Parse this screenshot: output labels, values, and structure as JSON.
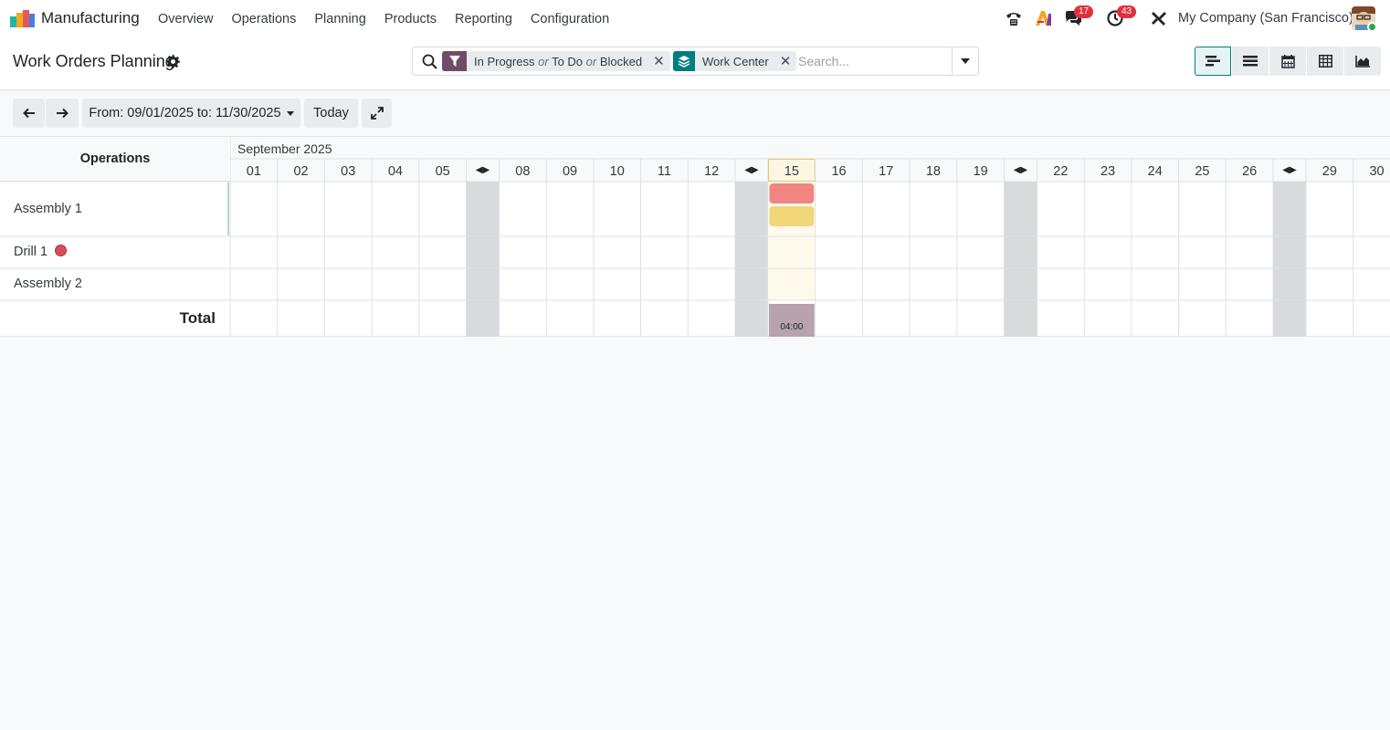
{
  "navbar": {
    "app_name": "Manufacturing",
    "menu": [
      "Overview",
      "Operations",
      "Planning",
      "Products",
      "Reporting",
      "Configuration"
    ],
    "messages_count": "17",
    "activities_count": "43",
    "company": "My Company (San Francisco)"
  },
  "control_panel": {
    "title": "Work Orders Planning",
    "filter_facet": {
      "parts": [
        "In Progress",
        "or",
        "To Do",
        "or",
        "Blocked"
      ]
    },
    "groupby_facet": {
      "label": "Work Center"
    },
    "search_placeholder": "Search...",
    "views": [
      "gantt",
      "list",
      "calendar",
      "pivot",
      "graph"
    ],
    "active_view": "gantt"
  },
  "gantt_controls": {
    "date_range": "From: 09/01/2025 to: 11/30/2025",
    "today_label": "Today"
  },
  "gantt": {
    "row_header": "Operations",
    "month": "September 2025",
    "columns": [
      {
        "label": "01"
      },
      {
        "label": "02"
      },
      {
        "label": "03"
      },
      {
        "label": "04"
      },
      {
        "label": "05"
      },
      {
        "collapsed": true
      },
      {
        "label": "08"
      },
      {
        "label": "09"
      },
      {
        "label": "10"
      },
      {
        "label": "11"
      },
      {
        "label": "12"
      },
      {
        "collapsed": true
      },
      {
        "label": "15",
        "today": true
      },
      {
        "label": "16"
      },
      {
        "label": "17"
      },
      {
        "label": "18"
      },
      {
        "label": "19"
      },
      {
        "collapsed": true
      },
      {
        "label": "22"
      },
      {
        "label": "23"
      },
      {
        "label": "24"
      },
      {
        "label": "25"
      },
      {
        "label": "26"
      },
      {
        "collapsed": true
      },
      {
        "label": "29"
      },
      {
        "label": "30"
      }
    ],
    "rows": [
      {
        "name": "Assembly 1",
        "has_alert": false
      },
      {
        "name": "Drill 1",
        "has_alert": true
      },
      {
        "name": "Assembly 2",
        "has_alert": false
      }
    ],
    "total_label": "Total",
    "total_value": "04:00",
    "pills": [
      {
        "row": "Assembly 1",
        "day": "15",
        "color": "#f28482"
      },
      {
        "row": "Assembly 1",
        "day": "15",
        "color": "#f1d67a"
      }
    ]
  }
}
